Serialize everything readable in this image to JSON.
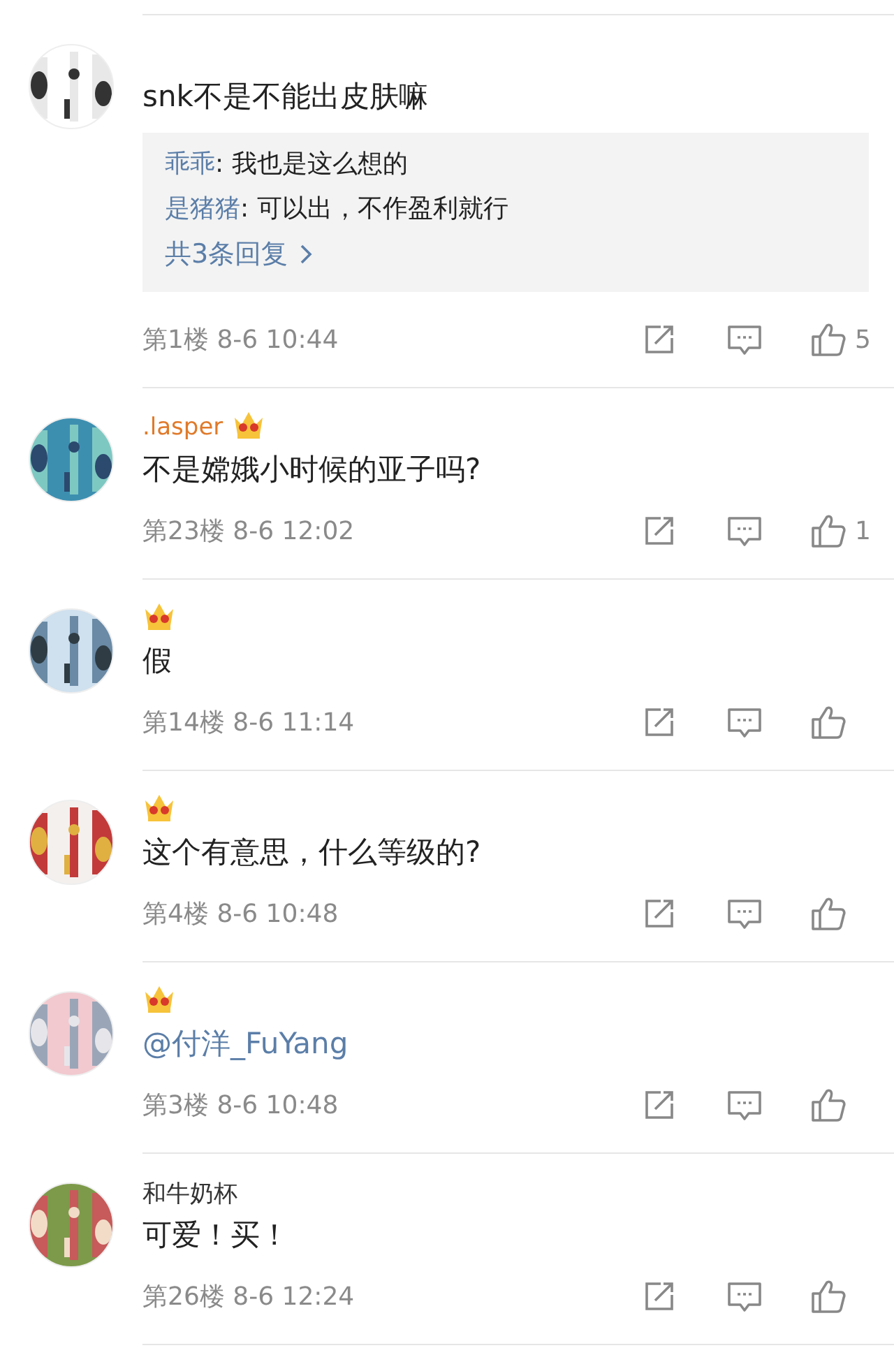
{
  "comments": [
    {
      "vip": false,
      "text": "snk不是不能出皮肤嘛",
      "mention": false,
      "replies": [
        {
          "user": "乖乖",
          "text": ": 我也是这么想的"
        },
        {
          "user": "是猪猪",
          "text": ": 可以出，不作盈利就行"
        }
      ],
      "more_replies": "共3条回复",
      "floor": "第1楼",
      "time": "8-6 10:44",
      "likes": "5"
    },
    {
      "username": ".lasper",
      "vip": true,
      "text": "不是嫦娥小时候的亚子吗?",
      "mention": false,
      "floor": "第23楼",
      "time": "8-6 12:02",
      "likes": "1"
    },
    {
      "vip": true,
      "text": "假",
      "mention": false,
      "floor": "第14楼",
      "time": "8-6 11:14"
    },
    {
      "vip": true,
      "text": "这个有意思，什么等级的?",
      "mention": false,
      "floor": "第4楼",
      "time": "8-6 10:48"
    },
    {
      "vip": true,
      "text": "@付洋_FuYang",
      "mention": true,
      "floor": "第3楼",
      "time": "8-6 10:48"
    },
    {
      "username": "和牛奶杯",
      "vip": false,
      "text": "可爱！买！",
      "mention": false,
      "floor": "第26楼",
      "time": "8-6 12:24"
    }
  ]
}
